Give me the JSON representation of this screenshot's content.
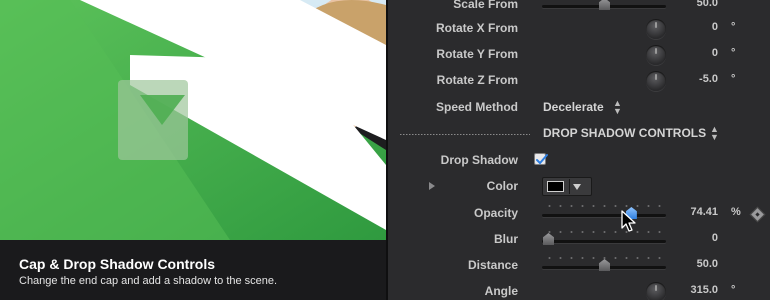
{
  "preview": {
    "caption_title": "Cap & Drop Shadow Controls",
    "caption_subtitle": "Change the end cap and add a shadow to the scene."
  },
  "inspector": {
    "rows": [
      {
        "label": "Scale From",
        "control": "slider",
        "value": "50.0",
        "slider_position": 0.5
      },
      {
        "label": "Rotate X From",
        "control": "dial",
        "value": "0",
        "unit": "°"
      },
      {
        "label": "Rotate Y From",
        "control": "dial",
        "value": "0",
        "unit": "°"
      },
      {
        "label": "Rotate Z From",
        "control": "dial",
        "value": "-5.0",
        "unit": "°"
      },
      {
        "label": "Speed Method",
        "control": "popup",
        "value": "Decelerate"
      }
    ],
    "section": {
      "label": "DROP SHADOW CONTROLS"
    },
    "drop_shadow": {
      "label": "Drop Shadow",
      "checked": true
    },
    "color": {
      "label": "Color",
      "swatch": "#000000"
    },
    "opacity": {
      "label": "Opacity",
      "value": "74.41",
      "unit": "%",
      "slider_position": 0.74
    },
    "blur": {
      "label": "Blur",
      "value": "0",
      "slider_position": 0.0
    },
    "distance": {
      "label": "Distance",
      "value": "50.0",
      "slider_position": 0.5
    },
    "angle": {
      "label": "Angle",
      "value": "315.0",
      "unit": "°"
    }
  },
  "colors": {
    "accent_blue": "#4a90e2",
    "preview_green": "#3fae49",
    "panel_bg": "#2b2b2d"
  }
}
